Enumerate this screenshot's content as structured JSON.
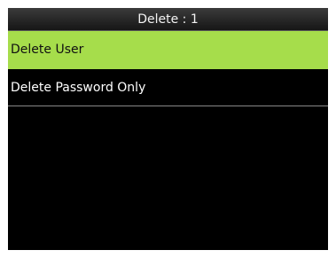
{
  "header": {
    "title": "Delete : 1"
  },
  "menu": {
    "selected_index": 0,
    "items": [
      {
        "label": "Delete User"
      },
      {
        "label": "Delete Password Only"
      }
    ]
  },
  "colors": {
    "screen_background": "#000000",
    "title_bar": "#2a2a2a",
    "selected_highlight": "#a6dd4b",
    "text": "#ffffff"
  }
}
